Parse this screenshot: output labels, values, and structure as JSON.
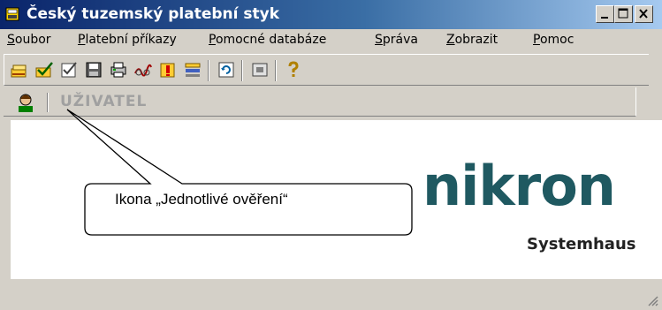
{
  "window": {
    "title": "Český tuzemský platební styk"
  },
  "title_buttons": [
    "minimize",
    "maximize",
    "close"
  ],
  "menu": [
    {
      "label": "Soubor",
      "accel": "S"
    },
    {
      "label": "Platební příkazy",
      "accel": "P"
    },
    {
      "label": "Pomocné databáze",
      "accel": "P"
    },
    {
      "label": "Správa",
      "accel": "S"
    },
    {
      "label": "Zobrazit",
      "accel": "Z"
    },
    {
      "label": "Pomoc",
      "accel": "P"
    }
  ],
  "toolbar": {
    "icons": [
      "payment-order-icon",
      "single-verification-icon",
      "verify-checklist-icon",
      "save-icon",
      "print-icon",
      "signature-icon",
      "export-icon",
      "list-icon",
      "refresh-icon",
      "window-icon",
      "help-icon"
    ]
  },
  "user": {
    "label": "UŽIVATEL"
  },
  "logo": {
    "brand": "nikron",
    "sub": "Systemhaus",
    "color": "#1f5961"
  },
  "callout": {
    "text": "Ikona „Jednotlivé ověření“"
  },
  "colors": {
    "titlebar_start": "#0a246a",
    "titlebar_end": "#a6caf0",
    "face": "#d4d0c8"
  }
}
